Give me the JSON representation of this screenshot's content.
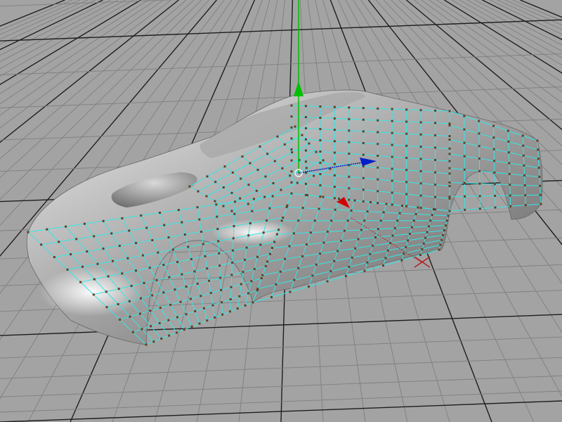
{
  "viewport": {
    "background_color": "#a3a3a3",
    "grid_color": "#7f7f7f",
    "grid_major_color": "#1e1e1e",
    "mesh_edge_color": "#35e6e6",
    "vertex_color": "#6b3a1f",
    "body_shade_light": "#ececec",
    "body_shade_mid": "#a9a9a9",
    "body_shade_dark": "#5c5c5c"
  },
  "model": {
    "object": "car-body-mesh",
    "selection": "polygons-selected"
  },
  "gizmo": {
    "type": "move-manipulator",
    "y_axis_color": "#00c000",
    "z_axis_color": "#0020c8",
    "x_axis_color": "#d00000",
    "pivot_icon": "pivot-circle-icon"
  },
  "grid": {
    "origin_marker": "origin-cross-icon",
    "origin_color": "#b22222"
  }
}
